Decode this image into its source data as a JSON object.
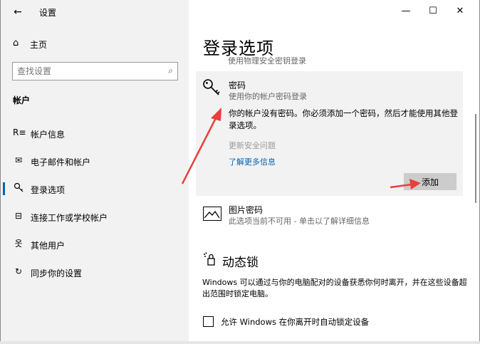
{
  "app": {
    "title": "设置",
    "back_glyph": "←"
  },
  "window_controls": {
    "minimize": "—",
    "maximize": "☐",
    "close": "✕"
  },
  "sidebar": {
    "home_label": "主页",
    "search": {
      "placeholder": "查找设置",
      "value": ""
    },
    "section_title": "帐户",
    "items": [
      {
        "label": "帐户信息",
        "icon": "person-card-icon",
        "glyph": "R≡"
      },
      {
        "label": "电子邮件和帐户",
        "icon": "mail-icon",
        "glyph": "✉"
      },
      {
        "label": "登录选项",
        "icon": "key-icon",
        "glyph": "🔍"
      },
      {
        "label": "连接工作或学校帐户",
        "icon": "briefcase-icon",
        "glyph": "⊟"
      },
      {
        "label": "其他用户",
        "icon": "person-add-icon",
        "glyph": "옷"
      },
      {
        "label": "同步你的设置",
        "icon": "sync-icon",
        "glyph": "↻"
      }
    ],
    "active_index": 2
  },
  "main": {
    "page_title": "登录选项",
    "partial_line": "使用物理安全密钥登录",
    "password": {
      "title": "密码",
      "description": "使用你的帐户密码登录",
      "warning": "你的帐户没有密码。你必须添加一个密码，然后才能使用其他登录选项。",
      "change_security": "更新安全问题",
      "learn_more": "了解更多信息",
      "add_button": "添加"
    },
    "picture_password": {
      "title": "图片密码",
      "description": "此选项当前不可用 - 单击以了解详细信息"
    },
    "dynamic_lock": {
      "title": "动态锁",
      "description": "Windows 可以通过与你的电脑配对的设备获悉你何时离开，并在这些设备超出范围时锁定电脑。",
      "checkbox_label": "允许 Windows 在你离开时自动锁定设备",
      "checked": false
    }
  },
  "colors": {
    "accent": "#0063b1",
    "annotation": "#e8403a",
    "sidebar_bg": "#f2f2f2",
    "panel_bg": "#f2f2f2",
    "button_bg": "#cccccc"
  }
}
